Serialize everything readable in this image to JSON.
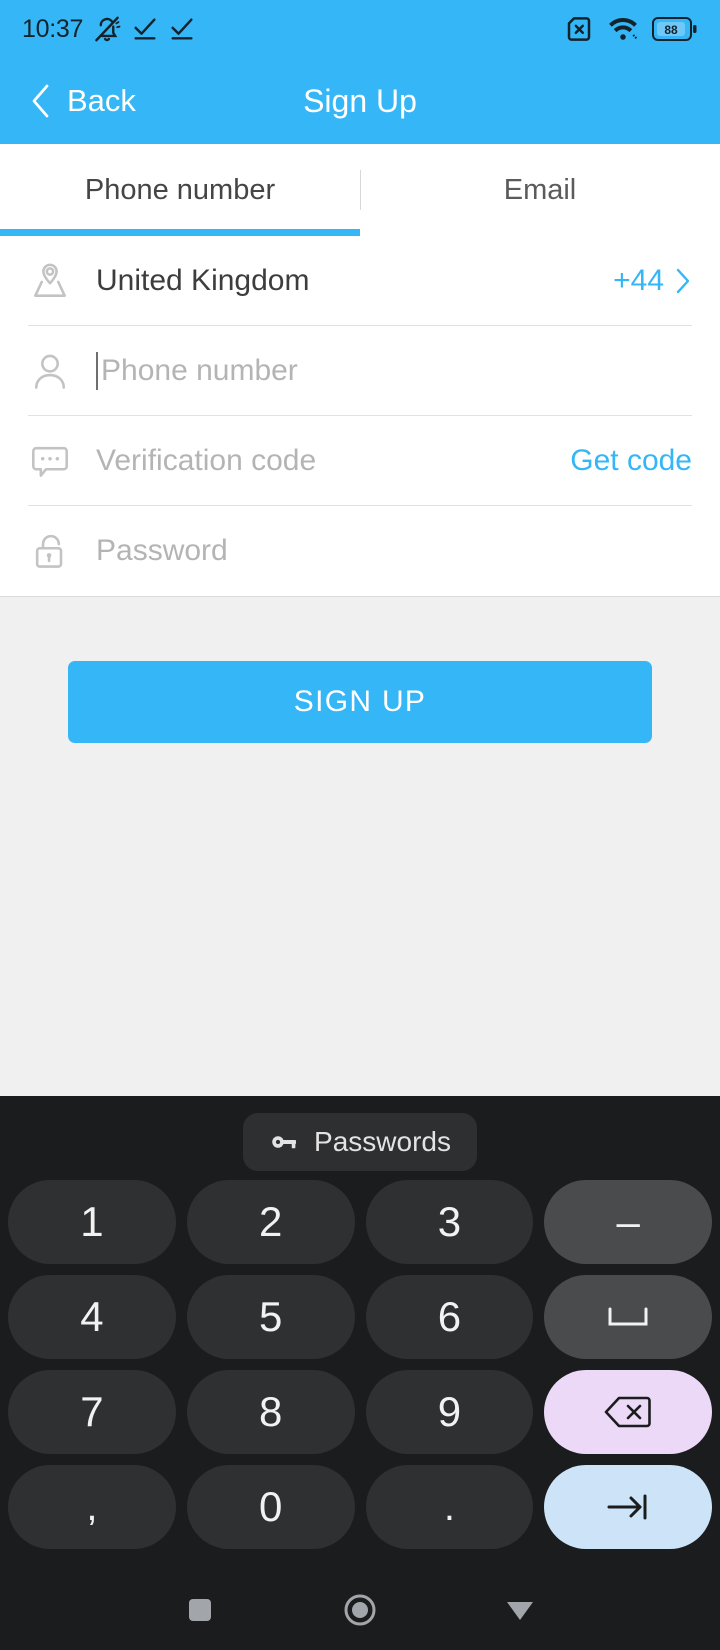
{
  "status_bar": {
    "time": "10:37",
    "icons_left": [
      "bell-muted-icon",
      "check-underline-icon",
      "check-underline-icon"
    ],
    "icons_right": [
      "sim-card-off-icon",
      "wifi-icon",
      "battery-icon"
    ],
    "battery_level": "88"
  },
  "app_bar": {
    "back_label": "Back",
    "title": "Sign Up",
    "accent_color": "#35B6F6"
  },
  "tabs": [
    {
      "label": "Phone number",
      "active": true
    },
    {
      "label": "Email",
      "active": false
    }
  ],
  "form": {
    "country": {
      "label": "United Kingdom",
      "dial_code": "+44"
    },
    "phone": {
      "placeholder": "Phone number",
      "value": ""
    },
    "verification": {
      "placeholder": "Verification code",
      "value": "",
      "action_label": "Get code"
    },
    "password": {
      "placeholder": "Password",
      "value": ""
    }
  },
  "cta": {
    "signup_label": "SIGN UP"
  },
  "keyboard": {
    "suggestion_label": "Passwords",
    "rows": [
      [
        {
          "label": "1",
          "type": "digit"
        },
        {
          "label": "2",
          "type": "digit"
        },
        {
          "label": "3",
          "type": "digit"
        },
        {
          "label": "–",
          "type": "func",
          "name": "dash-key"
        }
      ],
      [
        {
          "label": "4",
          "type": "digit"
        },
        {
          "label": "5",
          "type": "digit"
        },
        {
          "label": "6",
          "type": "digit"
        },
        {
          "label": "␣",
          "type": "func",
          "name": "space-key"
        }
      ],
      [
        {
          "label": "7",
          "type": "digit"
        },
        {
          "label": "8",
          "type": "digit"
        },
        {
          "label": "9",
          "type": "digit"
        },
        {
          "label": "",
          "type": "backspace",
          "name": "backspace-key"
        }
      ],
      [
        {
          "label": ",",
          "type": "digit"
        },
        {
          "label": "0",
          "type": "digit"
        },
        {
          "label": ".",
          "type": "digit"
        },
        {
          "label": "",
          "type": "enter",
          "name": "tab-next-key"
        }
      ]
    ]
  },
  "nav_bar": {
    "recents_label": "recents-square-icon",
    "home_label": "home-circle-icon",
    "hide_keyboard_label": "hide-keyboard-triangle-icon"
  }
}
